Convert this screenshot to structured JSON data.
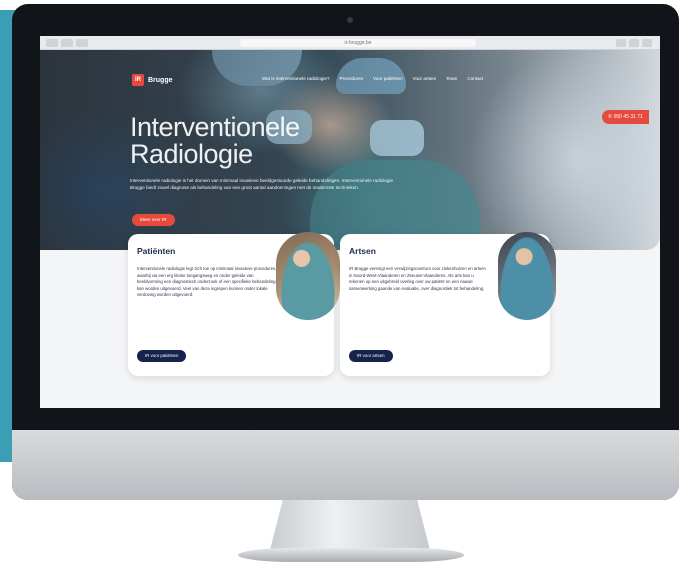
{
  "browser": {
    "url": "ir-brugge.be"
  },
  "site": {
    "logo_mark": "IR",
    "logo_name": "Brugge"
  },
  "nav": {
    "items": [
      "Wat is interventionele radiologie?",
      "Procedures",
      "Voor patiënten",
      "Voor artsen",
      "Team",
      "Contact"
    ]
  },
  "hero": {
    "phone": "050 45 31 71",
    "title_line1": "Interventionele",
    "title_line2": "Radiologie",
    "text": "Interventionele radiologie is het domein van minimaal invasieve beeldgestuurde geleide behandelingen. Interventionele radiologie Brugge biedt zowel diagnose als behandeling van een groot aantal aandoeningen met de modernste technieken.",
    "button": "Meer over IR"
  },
  "cards": {
    "patients": {
      "title": "Patiënten",
      "text": "Interventionele radiologie legt zich toe op minimaal invasieve procedures, waarbij via een erg kleine toegangsweg en onder geleide van beeldvorming een diagnostisch onderzoek of een specifieke behandeling kan worden uitgevoerd. Veel van deze ingrepen kunnen onder lokale verdoving worden uitgevoerd.",
      "button": "IR voor patiënten"
    },
    "doctors": {
      "title": "Artsen",
      "text": "IR Brugge verenigt een verwijzingscentrum voor ziekenhuizen en artsen in Noord-West-Vlaanderen en Zeeuws-Vlaanderen. Als arts kan u rekenen op een uitgebreid overleg over uw patiënt en een nauwe samenwerking gaande van evaluatie, over diagnostiek tot behandeling.",
      "button": "IR voor artsen"
    }
  },
  "colors": {
    "accent": "#e64a3c",
    "navy": "#16234a",
    "teal_panel": "#3a9fb4"
  }
}
